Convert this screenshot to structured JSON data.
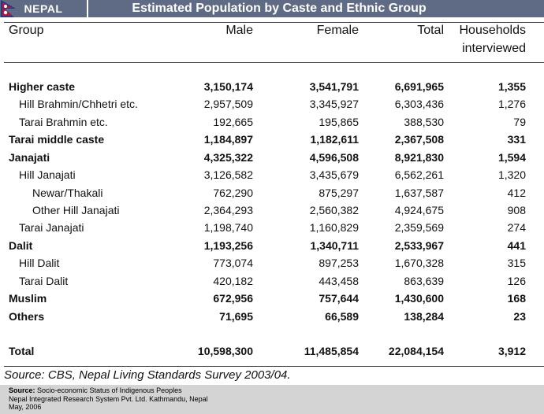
{
  "header": {
    "country": "NEPAL",
    "title": "Estimated Population by Caste and Ethnic Group",
    "background_color": "#5f6b84"
  },
  "table": {
    "columns": {
      "group": "Group",
      "male": "Male",
      "female": "Female",
      "total": "Total",
      "households_line1": "Households",
      "households_line2": "interviewed"
    },
    "rows": [
      {
        "label": "Higher caste",
        "level": 0,
        "bold": true,
        "male": "3,150,174",
        "female": "3,541,791",
        "total": "6,691,965",
        "households": "1,355"
      },
      {
        "label": "Hill Brahmin/Chhetri etc.",
        "level": 1,
        "bold": false,
        "male": "2,957,509",
        "female": "3,345,927",
        "total": "6,303,436",
        "households": "1,276"
      },
      {
        "label": "Tarai Brahmin etc.",
        "level": 1,
        "bold": false,
        "male": "192,665",
        "female": "195,865",
        "total": "388,530",
        "households": "79"
      },
      {
        "label": "Tarai middle caste",
        "level": 0,
        "bold": true,
        "male": "1,184,897",
        "female": "1,182,611",
        "total": "2,367,508",
        "households": "331"
      },
      {
        "label": "Janajati",
        "level": 0,
        "bold": true,
        "male": "4,325,322",
        "female": "4,596,508",
        "total": "8,921,830",
        "households": "1,594"
      },
      {
        "label": "Hill Janajati",
        "level": 1,
        "bold": false,
        "male": "3,126,582",
        "female": "3,435,679",
        "total": "6,562,261",
        "households": "1,320"
      },
      {
        "label": "Newar/Thakali",
        "level": 2,
        "bold": false,
        "male": "762,290",
        "female": "875,297",
        "total": "1,637,587",
        "households": "412"
      },
      {
        "label": "Other Hill Janajati",
        "level": 2,
        "bold": false,
        "male": "2,364,293",
        "female": "2,560,382",
        "total": "4,924,675",
        "households": "908"
      },
      {
        "label": "Tarai Janajati",
        "level": 1,
        "bold": false,
        "male": "1,198,740",
        "female": "1,160,829",
        "total": "2,359,569",
        "households": "274"
      },
      {
        "label": "Dalit",
        "level": 0,
        "bold": true,
        "male": "1,193,256",
        "female": "1,340,711",
        "total": "2,533,967",
        "households": "441"
      },
      {
        "label": "Hill Dalit",
        "level": 1,
        "bold": false,
        "male": "773,074",
        "female": "897,253",
        "total": "1,670,328",
        "households": "315"
      },
      {
        "label": "Tarai Dalit",
        "level": 1,
        "bold": false,
        "male": "420,182",
        "female": "443,458",
        "total": "863,639",
        "households": "126"
      },
      {
        "label": "Muslim",
        "level": 0,
        "bold": true,
        "male": "672,956",
        "female": "757,644",
        "total": "1,430,600",
        "households": "168"
      },
      {
        "label": "Others",
        "level": 0,
        "bold": true,
        "male": "71,695",
        "female": "66,589",
        "total": "138,284",
        "households": "23"
      }
    ],
    "total_row": {
      "label": "Total",
      "level": 0,
      "bold": true,
      "male": "10,598,300",
      "female": "11,485,854",
      "total": "22,084,154",
      "households": "3,912"
    }
  },
  "source_note": "Source: CBS, Nepal Living Standards Survey 2003/04.",
  "footer": {
    "source_label": "Source:",
    "source_title": " Socio-economic Status of Indigenous Peoples",
    "line2": "Nepal Integrated Research System Pvt. Ltd. Kathmandu, Nepal",
    "line3": "May, 2006"
  }
}
